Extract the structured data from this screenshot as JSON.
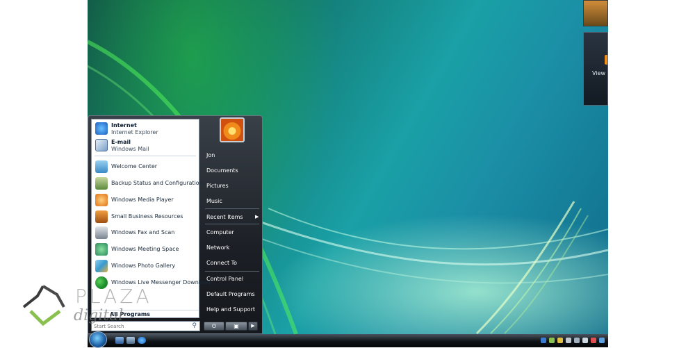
{
  "start_menu": {
    "pinned": [
      {
        "title": "Internet",
        "subtitle": "Internet Explorer",
        "icon": "internet-explorer-icon"
      },
      {
        "title": "E-mail",
        "subtitle": "Windows Mail",
        "icon": "windows-mail-icon"
      }
    ],
    "recent_programs": [
      {
        "label": "Welcome Center",
        "icon": "welcome-center-icon"
      },
      {
        "label": "Backup Status and Configuration",
        "icon": "backup-icon"
      },
      {
        "label": "Windows Media Player",
        "icon": "media-player-icon"
      },
      {
        "label": "Small Business Resources",
        "icon": "business-resources-icon"
      },
      {
        "label": "Windows Fax and Scan",
        "icon": "fax-scan-icon"
      },
      {
        "label": "Windows Meeting Space",
        "icon": "meeting-space-icon"
      },
      {
        "label": "Windows Photo Gallery",
        "icon": "photo-gallery-icon"
      },
      {
        "label": "Windows Live Messenger Download",
        "icon": "messenger-icon"
      }
    ],
    "all_programs": "All Programs",
    "search_placeholder": "Start Search",
    "user_name": "Jon",
    "right_items": [
      {
        "label": "Documents"
      },
      {
        "label": "Pictures"
      },
      {
        "label": "Music"
      },
      {
        "label": "Recent Items"
      },
      {
        "label": "Computer"
      },
      {
        "label": "Network"
      },
      {
        "label": "Connect To"
      },
      {
        "label": "Control Panel"
      },
      {
        "label": "Default Programs"
      },
      {
        "label": "Help and Support"
      }
    ]
  },
  "sidebar": {
    "feed_text": "View h"
  },
  "watermark": {
    "line1": "PLAZA",
    "line2": "digital"
  },
  "colors": {
    "accent": "#1a5aa0",
    "menu_dark": "#1c2026"
  }
}
